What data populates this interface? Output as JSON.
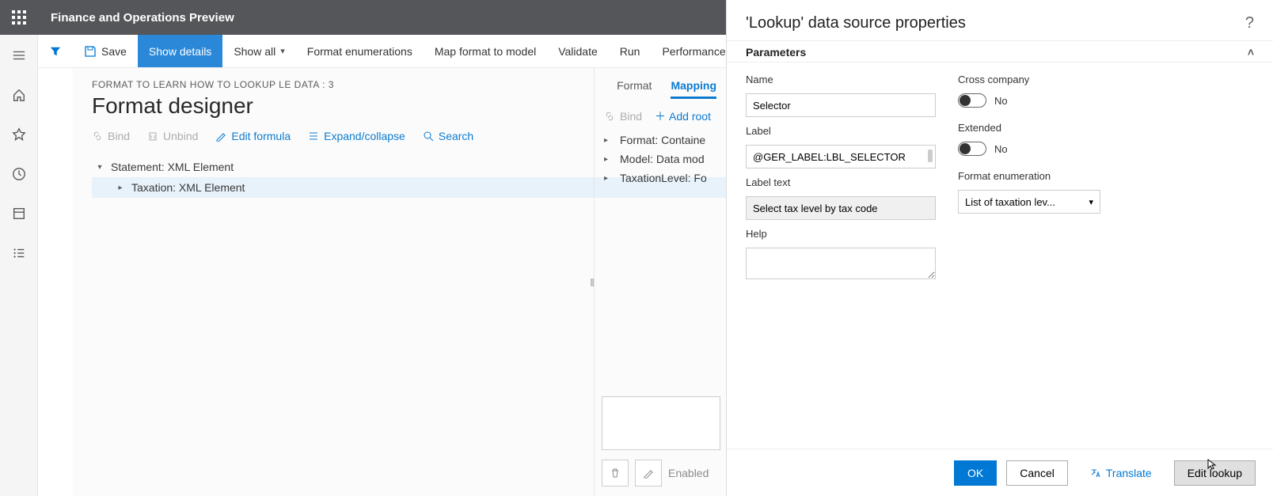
{
  "topbar": {
    "app_title": "Finance and Operations Preview"
  },
  "toolbar": {
    "save_label": "Save",
    "show_details_label": "Show details",
    "show_all_label": "Show all",
    "format_enumerations": "Format enumerations",
    "map_format_to_model": "Map format to model",
    "validate": "Validate",
    "run": "Run",
    "performance": "Performance t"
  },
  "page": {
    "overline": "FORMAT TO LEARN HOW TO LOOKUP LE DATA : 3",
    "title": "Format designer"
  },
  "actions": {
    "bind": "Bind",
    "unbind": "Unbind",
    "edit_formula": "Edit formula",
    "expand_collapse": "Expand/collapse",
    "search": "Search"
  },
  "tree": {
    "items": [
      {
        "label": "Statement: XML Element",
        "level": 0,
        "expanded": true,
        "selected": false
      },
      {
        "label": "Taxation: XML Element",
        "level": 1,
        "expanded": false,
        "selected": true
      }
    ]
  },
  "right": {
    "tabs": {
      "format": "Format",
      "mapping": "Mapping"
    },
    "bind": "Bind",
    "add_root": "Add root",
    "items": [
      "Format: Containe",
      "Model: Data mod",
      "TaxationLevel: Fo"
    ],
    "enabled_label": "Enabled"
  },
  "panel": {
    "title": "'Lookup' data source properties",
    "section": "Parameters",
    "fields": {
      "name_label": "Name",
      "name_value": "Selector",
      "label_label": "Label",
      "label_value": "@GER_LABEL:LBL_SELECTOR",
      "label_text_label": "Label text",
      "label_text_value": "Select tax level by tax code",
      "help_label": "Help",
      "help_value": "",
      "cross_company_label": "Cross company",
      "cross_company_value": "No",
      "extended_label": "Extended",
      "extended_value": "No",
      "format_enum_label": "Format enumeration",
      "format_enum_value": "List of taxation lev..."
    },
    "footer": {
      "ok": "OK",
      "cancel": "Cancel",
      "translate": "Translate",
      "edit_lookup": "Edit lookup"
    }
  }
}
